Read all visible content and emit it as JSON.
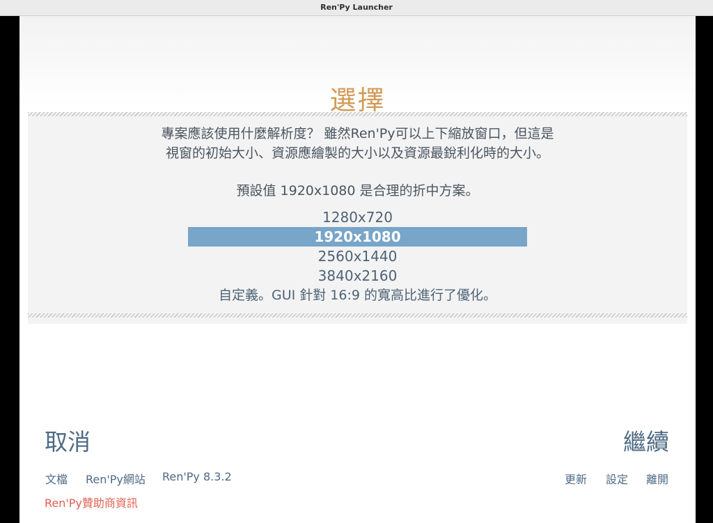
{
  "window": {
    "title": "Ren'Py Launcher"
  },
  "screen": {
    "title": "選擇"
  },
  "description": {
    "line1": "專案應該使用什麼解析度？ 雖然Ren'Py可以上下縮放窗口，但這是",
    "line2": "視窗的初始大小、資源應繪製的大小以及資源最銳利化時的大小。",
    "default_note": "預設值 1920x1080 是合理的折中方案。"
  },
  "resolutions": {
    "selected": "1920x1080",
    "items": [
      "1280x720",
      "1920x1080",
      "2560x1440",
      "3840x2160"
    ],
    "custom": "自定義。GUI 針對 16:9 的寬高比進行了優化。"
  },
  "actions": {
    "cancel": "取消",
    "continue": "繼續"
  },
  "footer": {
    "docs": "文檔",
    "website": "Ren'Py網站",
    "version": "Ren'Py 8.3.2",
    "update": "更新",
    "preferences": "設定",
    "quit": "離開",
    "sponsor": "Ren'Py贊助商資訊"
  },
  "colors": {
    "title_accent": "#d29a55",
    "selection": "#78a5c8",
    "link": "#4e6a84",
    "sponsor": "#e05f4f"
  }
}
